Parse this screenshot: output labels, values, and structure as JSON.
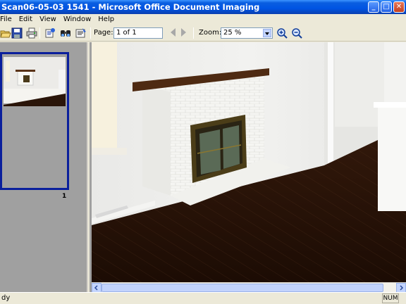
{
  "window": {
    "title": "Scan06-05-03 1541 - Microsoft Office Document Imaging",
    "buttons": {
      "minimize": "_",
      "maximize": "□",
      "close": "✕"
    }
  },
  "menu": {
    "items": [
      "File",
      "Edit",
      "View",
      "Window",
      "Help"
    ]
  },
  "toolbar": {
    "icons": [
      "open-icon",
      "save-icon",
      "print-icon",
      "send-to-word-icon",
      "find-icon",
      "recognize-text-icon"
    ],
    "page_label": "Page:",
    "page_value": "1 of 1",
    "zoom_label": "Zoom:",
    "zoom_value": "25 %"
  },
  "thumbnails": {
    "pages": [
      {
        "number": "1",
        "selected": true
      }
    ]
  },
  "status": {
    "text": "dy",
    "num_indicator": "NUM"
  },
  "colors": {
    "titlebar": "#0054e3",
    "selection_border": "#0a1f9c",
    "pane_bg": "#a0a0a0"
  }
}
